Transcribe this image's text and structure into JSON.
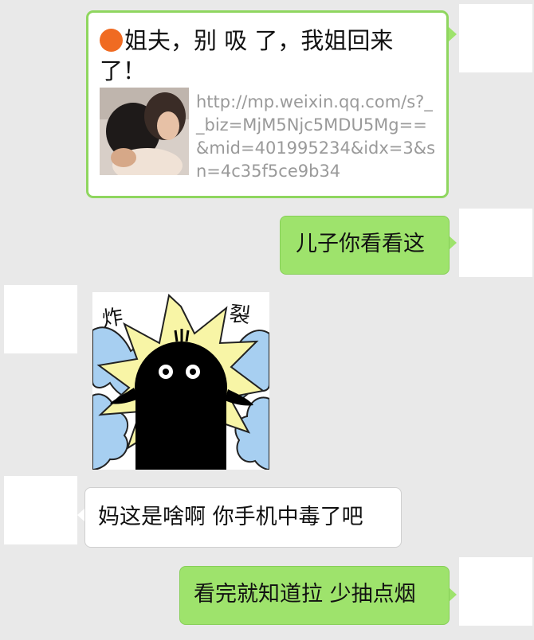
{
  "messages": [
    {
      "type": "link",
      "side": "right",
      "title": "姐夫，别 吸 了，我姐回来了！",
      "url": "http://mp.weixin.qq.com/s?__biz=MjM5Njc5MDU5Mg==&mid=401995234&idx=3&sn=4c35f5ce9b34",
      "thumbnail_icon": "photo-thumbnail"
    },
    {
      "type": "text",
      "side": "right",
      "text": "儿子你看看这"
    },
    {
      "type": "sticker",
      "side": "left",
      "label_left": "炸",
      "label_right": "裂"
    },
    {
      "type": "text",
      "side": "left",
      "text": "妈这是啥啊 你手机中毒了吧"
    },
    {
      "type": "text",
      "side": "right",
      "text": "看完就知道拉 少抽点烟"
    }
  ],
  "colors": {
    "background": "#e9e9e9",
    "sent_bubble": "#9ee36c",
    "received_bubble": "#ffffff",
    "link_border": "#8fd65f",
    "url_text": "#9a9a9a",
    "dot": "#f06b22"
  }
}
